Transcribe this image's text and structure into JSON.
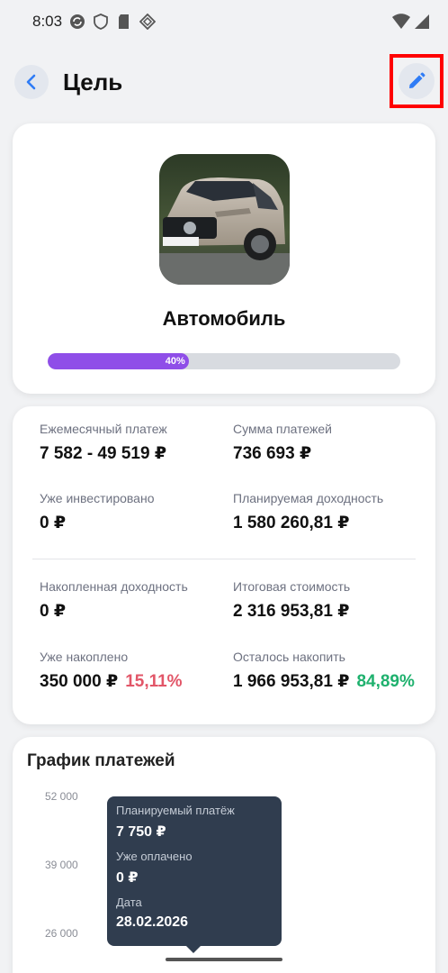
{
  "status_bar": {
    "time": "8:03"
  },
  "header": {
    "title": "Цель"
  },
  "goal": {
    "name": "Автомобиль",
    "progress_label": "40%",
    "progress_value": 0.4
  },
  "stats": {
    "monthly_payment": {
      "label": "Ежемесячный платеж",
      "value": "7 582 - 49 519 ₽"
    },
    "payments_sum": {
      "label": "Сумма платежей",
      "value": "736 693 ₽"
    },
    "already_invested": {
      "label": "Уже инвестировано",
      "value": "0 ₽"
    },
    "planned_yield": {
      "label": "Планируемая доходность",
      "value": "1 580 260,81 ₽"
    },
    "accumulated_yield": {
      "label": "Накопленная доходность",
      "value": "0 ₽"
    },
    "total_cost": {
      "label": "Итоговая стоимость",
      "value": "2 316 953,81 ₽"
    },
    "already_saved": {
      "label": "Уже накоплено",
      "value": "350 000 ₽",
      "percent": "15,11%"
    },
    "left_to_save": {
      "label": "Осталось накопить",
      "value": "1 966 953,81 ₽",
      "percent": "84,89%"
    }
  },
  "chart": {
    "title": "График платежей",
    "y_ticks": [
      "52 000",
      "39 000",
      "26 000"
    ],
    "tooltip": {
      "planned_label": "Планируемый платёж",
      "planned_value": "7 750 ₽",
      "paid_label": "Уже оплачено",
      "paid_value": "0 ₽",
      "date_label": "Дата",
      "date_value": "28.02.2026"
    }
  },
  "colors": {
    "accent": "#8f4ee8",
    "positive": "#1fb16e",
    "negative": "#e25668",
    "tooltip_bg": "#303d4f"
  },
  "icons": {
    "back": "chevron-left-icon",
    "edit": "pencil-icon"
  }
}
